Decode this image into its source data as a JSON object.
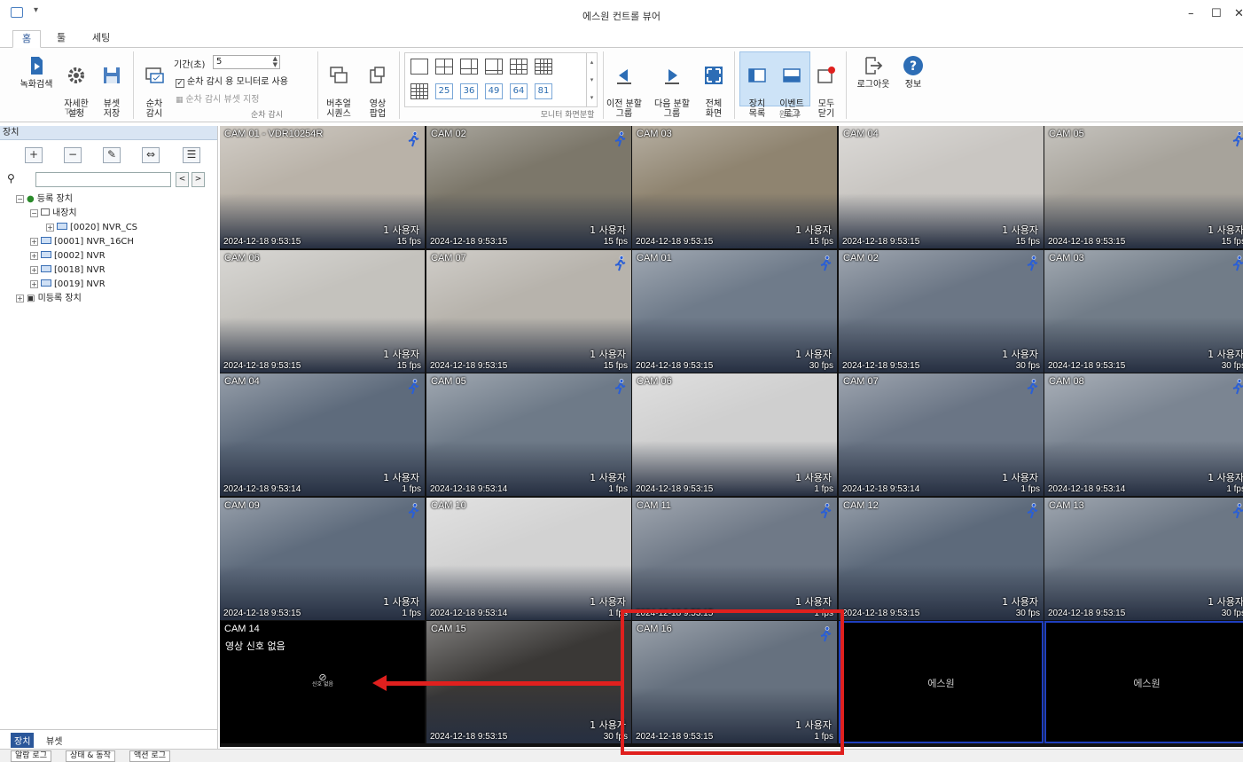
{
  "window": {
    "title": "에스원 컨트롤 뷰어",
    "quick_access": "▾",
    "controls": {
      "minimize": "–",
      "maximize": "☐",
      "close": "✕"
    }
  },
  "ribbon_tabs": [
    "홈",
    "툴",
    "세팅"
  ],
  "ribbon": {
    "tool_group": {
      "label": "Tool",
      "buttons": [
        {
          "label": "녹화검색",
          "icon": "record-search-icon"
        },
        {
          "label": "자세한\n설정",
          "icon": "gear-icon"
        },
        {
          "label": "뷰셋\n저장",
          "icon": "save-viewset-icon"
        }
      ]
    },
    "sequence_group": {
      "label": "순차 감시",
      "button": "순차\n감시",
      "period_label": "기간(초)",
      "period_value": "5",
      "check_monitor": "순차 감시 용 모니터로 사용",
      "viewset_link": "순차 감시 뷰셋 지정"
    },
    "virtual": {
      "label": "버추얼\n시퀀스"
    },
    "popup": {
      "label": "영상\n팝업"
    },
    "split_group": {
      "label": "모니터 화면분할",
      "counts": [
        "25",
        "36",
        "49",
        "64",
        "81"
      ]
    },
    "nav_buttons": [
      {
        "label": "이전 분할\n그룹",
        "icon": "prev-group-icon"
      },
      {
        "label": "다음 분할\n그룹",
        "icon": "next-group-icon"
      },
      {
        "label": "전체\n화면",
        "icon": "fullscreen-icon"
      }
    ],
    "window_group": {
      "label": "윈도우",
      "buttons": [
        {
          "label": "장치\n목록",
          "icon": "device-list-icon"
        },
        {
          "label": "이벤트\n로그",
          "icon": "event-log-icon"
        },
        {
          "label": "모두\n닫기",
          "icon": "close-all-icon"
        }
      ]
    },
    "logout": "로그아웃",
    "info": "정보"
  },
  "left_panel": {
    "header": "장치",
    "toolbar": [
      "+",
      "−",
      "✎",
      "⇔",
      "☰"
    ],
    "search_placeholder": "",
    "tree": [
      {
        "label": "등록 장치",
        "level": 0,
        "exp": "−"
      },
      {
        "label": "내장치",
        "level": 1,
        "exp": "−"
      },
      {
        "label": "[0020] NVR_CS",
        "level": 2,
        "exp": "+"
      },
      {
        "label": "[0001] NVR_16CH",
        "level": 1,
        "exp": "+"
      },
      {
        "label": "[0002] NVR",
        "level": 1,
        "exp": "+"
      },
      {
        "label": "[0018] NVR",
        "level": 1,
        "exp": "+"
      },
      {
        "label": "[0019] NVR",
        "level": 1,
        "exp": "+"
      },
      {
        "label": "미등록 장치",
        "level": 0,
        "exp": "+"
      }
    ],
    "bottom_tabs": [
      "장치",
      "뷰셋"
    ]
  },
  "status_tabs": [
    "알람 로그",
    "상태 & 동작",
    "액션 로그"
  ],
  "tiles": [
    {
      "cam": "CAM 01 - VDR10254R",
      "ts": "2024-12-18 9:53:15",
      "users": "1 사용자",
      "fps": "15 fps",
      "motion": true,
      "tone": "#b9b2a8"
    },
    {
      "cam": "CAM 02",
      "ts": "2024-12-18 9:53:15",
      "users": "1 사용자",
      "fps": "15 fps",
      "motion": true,
      "tone": "#7c776a"
    },
    {
      "cam": "CAM 03",
      "ts": "2024-12-18 9:53:15",
      "users": "1 사용자",
      "fps": "15 fps",
      "motion": false,
      "tone": "#8f8470"
    },
    {
      "cam": "CAM 04",
      "ts": "2024-12-18 9:53:15",
      "users": "1 사용자",
      "fps": "15 fps",
      "motion": false,
      "tone": "#c9c6c2"
    },
    {
      "cam": "CAM 05",
      "ts": "2024-12-18 9:53:15",
      "users": "1 사용자",
      "fps": "15 fps",
      "motion": true,
      "tone": "#a7a39b"
    },
    {
      "cam": "CAM 06",
      "ts": "2024-12-18 9:53:15",
      "users": "1 사용자",
      "fps": "15 fps",
      "motion": false,
      "tone": "#c4c2bd"
    },
    {
      "cam": "CAM 07",
      "ts": "2024-12-18 9:53:15",
      "users": "1 사용자",
      "fps": "15 fps",
      "motion": true,
      "tone": "#b7b3ac"
    },
    {
      "cam": "CAM 01",
      "ts": "2024-12-18 9:53:15",
      "users": "1 사용자",
      "fps": "30 fps",
      "motion": true,
      "tone": "#6f7b8a"
    },
    {
      "cam": "CAM 02",
      "ts": "2024-12-18 9:53:15",
      "users": "1 사용자",
      "fps": "30 fps",
      "motion": true,
      "tone": "#6b7685"
    },
    {
      "cam": "CAM 03",
      "ts": "2024-12-18 9:53:15",
      "users": "1 사용자",
      "fps": "30 fps",
      "motion": true,
      "tone": "#717c88"
    },
    {
      "cam": "CAM 04",
      "ts": "2024-12-18 9:53:14",
      "users": "1 사용자",
      "fps": "1 fps",
      "motion": true,
      "tone": "#5e6b7c"
    },
    {
      "cam": "CAM 05",
      "ts": "2024-12-18 9:53:14",
      "users": "1 사용자",
      "fps": "1 fps",
      "motion": true,
      "tone": "#6e7a88"
    },
    {
      "cam": "CAM 06",
      "ts": "2024-12-18 9:53:15",
      "users": "1 사용자",
      "fps": "1 fps",
      "motion": false,
      "tone": "#cfcfcf"
    },
    {
      "cam": "CAM 07",
      "ts": "2024-12-18 9:53:14",
      "users": "1 사용자",
      "fps": "1 fps",
      "motion": true,
      "tone": "#6a7585"
    },
    {
      "cam": "CAM 08",
      "ts": "2024-12-18 9:53:14",
      "users": "1 사용자",
      "fps": "1 fps",
      "motion": true,
      "tone": "#7b8592"
    },
    {
      "cam": "CAM 09",
      "ts": "2024-12-18 9:53:15",
      "users": "1 사용자",
      "fps": "1 fps",
      "motion": true,
      "tone": "#5f6c7d"
    },
    {
      "cam": "CAM 10",
      "ts": "2024-12-18 9:53:14",
      "users": "1 사용자",
      "fps": "1 fps",
      "motion": false,
      "tone": "#d2d2d2"
    },
    {
      "cam": "CAM 11",
      "ts": "2024-12-18 9:53:15",
      "users": "1 사용자",
      "fps": "1 fps",
      "motion": true,
      "tone": "#6f7987"
    },
    {
      "cam": "CAM 12",
      "ts": "2024-12-18 9:53:15",
      "users": "1 사용자",
      "fps": "30 fps",
      "motion": true,
      "tone": "#5d6a7b"
    },
    {
      "cam": "CAM 13",
      "ts": "2024-12-18 9:53:15",
      "users": "1 사용자",
      "fps": "30 fps",
      "motion": true,
      "tone": "#6c7785"
    },
    {
      "cam": "CAM 14",
      "nosig_title": "영상 신호 없음",
      "nosig_mini": "신호 없음",
      "kind": "nosig"
    },
    {
      "cam": "CAM 15",
      "ts": "2024-12-18 9:53:15",
      "users": "1 사용자",
      "fps": "30 fps",
      "motion": false,
      "tone": "#3a3836"
    },
    {
      "cam": "CAM 16",
      "ts": "2024-12-18 9:53:15",
      "users": "1 사용자",
      "fps": "1 fps",
      "motion": true,
      "tone": "#66717f"
    },
    {
      "kind": "empty",
      "label": "에스원"
    },
    {
      "kind": "empty",
      "label": "에스원"
    }
  ]
}
